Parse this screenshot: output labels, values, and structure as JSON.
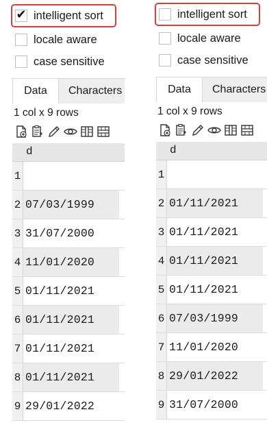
{
  "panels": [
    {
      "options": {
        "intelligent_sort": {
          "label": "intelligent sort",
          "checked": true,
          "mark": "✔"
        },
        "locale_aware": {
          "label": "locale aware",
          "checked": false
        },
        "case_sensitive": {
          "label": "case sensitive",
          "checked": false
        }
      },
      "tabs": {
        "data": "Data",
        "characters": "Characters"
      },
      "row_count": "1 col x 9 rows",
      "toolbar": [
        "add-file-icon",
        "paste-icon",
        "pencil-icon",
        "eye-icon",
        "columns-icon",
        "rows-icon"
      ],
      "grid": {
        "column": "d",
        "row_numbers": [
          "1",
          "2",
          "3",
          "4",
          "5",
          "6",
          "7",
          "8",
          "9"
        ],
        "values": [
          "",
          "07/03/1999",
          "31/07/2000",
          "11/01/2020",
          "01/11/2021",
          "01/11/2021",
          "01/11/2021",
          "01/11/2021",
          "29/01/2022"
        ]
      }
    },
    {
      "options": {
        "intelligent_sort": {
          "label": "intelligent sort",
          "checked": false
        },
        "locale_aware": {
          "label": "locale aware",
          "checked": false
        },
        "case_sensitive": {
          "label": "case sensitive",
          "checked": false
        }
      },
      "tabs": {
        "data": "Data",
        "characters": "Characters"
      },
      "row_count": "1 col x 9 rows",
      "toolbar": [
        "add-file-icon",
        "paste-icon",
        "pencil-icon",
        "eye-icon",
        "columns-icon",
        "rows-icon"
      ],
      "grid": {
        "column": "d",
        "row_numbers": [
          "1",
          "2",
          "3",
          "4",
          "5",
          "6",
          "7",
          "8",
          "9"
        ],
        "values": [
          "",
          "01/11/2021",
          "01/11/2021",
          "01/11/2021",
          "01/11/2021",
          "07/03/1999",
          "11/01/2020",
          "29/01/2022",
          "31/07/2000"
        ]
      }
    }
  ],
  "colors": {
    "highlight": "#e03b3b",
    "stripe": "#ebebeb"
  }
}
